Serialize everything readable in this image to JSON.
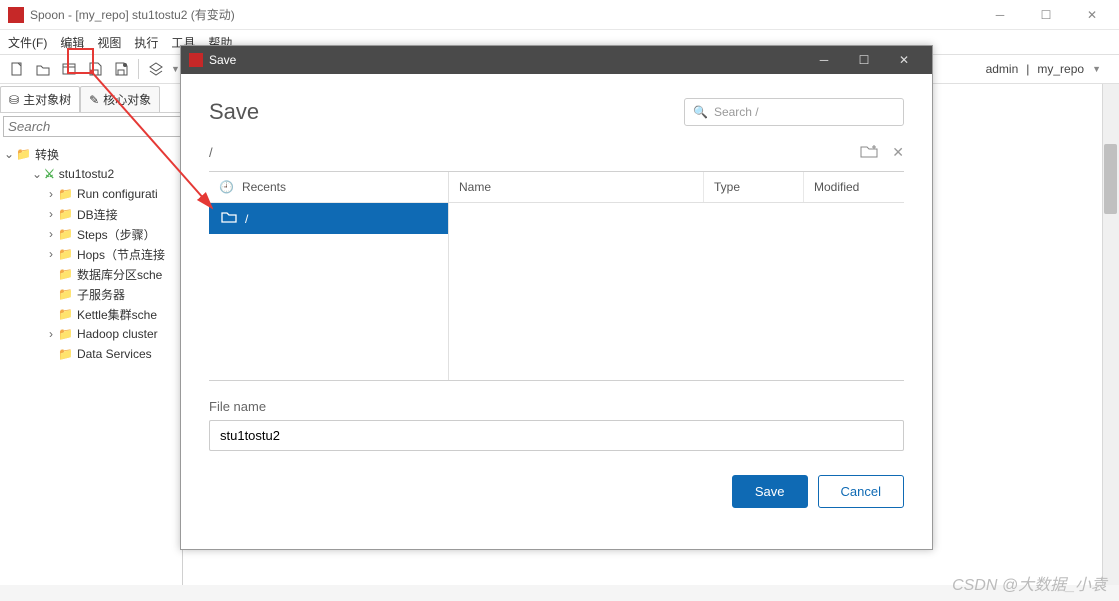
{
  "window": {
    "title": "Spoon - [my_repo] stu1tostu2 (有变动)"
  },
  "menu": [
    "文件(F)",
    "编辑",
    "视图",
    "执行",
    "工具",
    "帮助"
  ],
  "toolbar_right": {
    "user": "admin",
    "repo": "my_repo"
  },
  "sidebar": {
    "tab1": "主对象树",
    "tab2": "核心对象",
    "search_placeholder": "Search",
    "root": "转换",
    "job": "stu1tostu2",
    "items": [
      "Run configurati",
      "DB连接",
      "Steps（步骤）",
      "Hops（节点连接",
      "数据库分区sche",
      "子服务器",
      "Kettle集群sche",
      "Hadoop cluster",
      "Data Services"
    ]
  },
  "dialog": {
    "title": "Save",
    "heading": "Save",
    "search_placeholder": "Search /",
    "breadcrumb": "/",
    "recents_label": "Recents",
    "selected_recent": "/",
    "columns": {
      "name": "Name",
      "type": "Type",
      "modified": "Modified"
    },
    "filename_label": "File name",
    "filename_value": "stu1tostu2",
    "save_btn": "Save",
    "cancel_btn": "Cancel"
  },
  "watermark": "CSDN @大数据_小袁"
}
